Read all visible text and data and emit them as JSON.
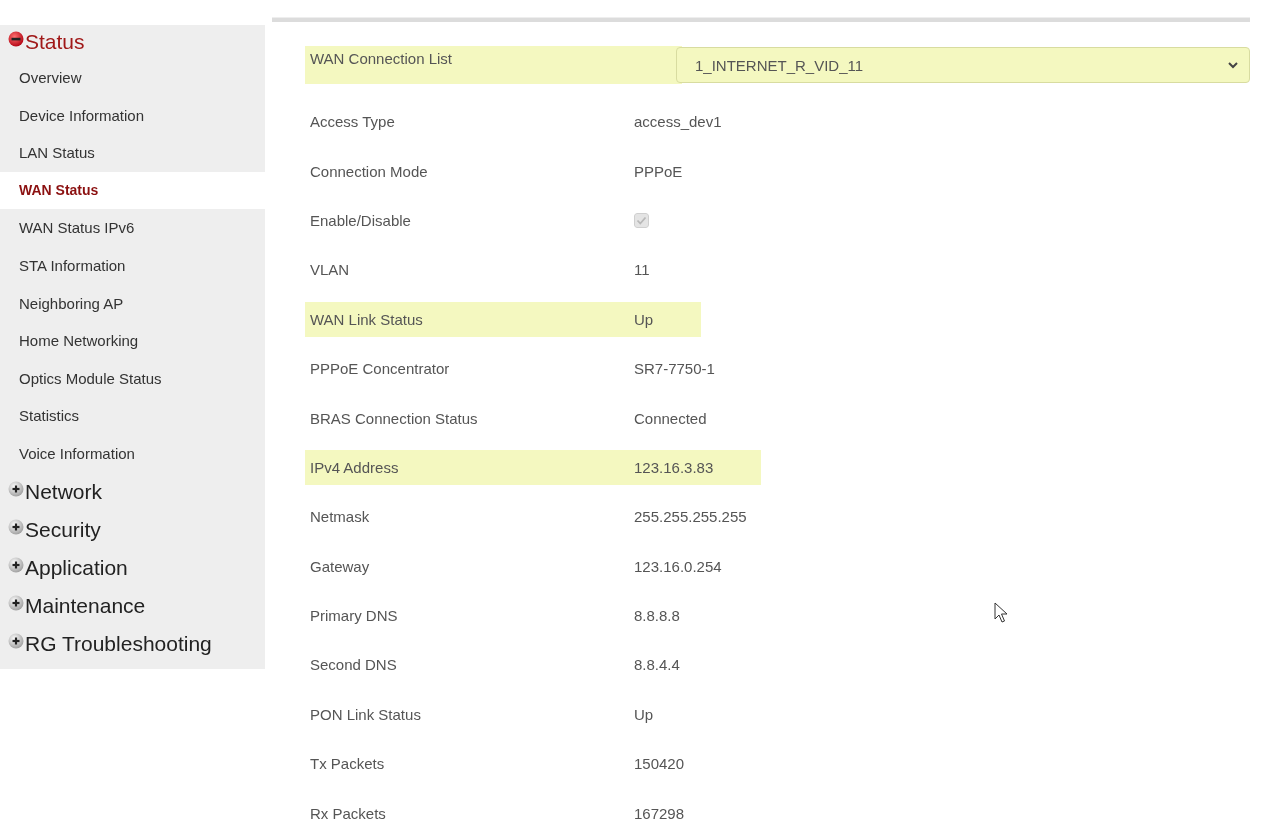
{
  "sidebar": {
    "groups": [
      {
        "label": "Status",
        "expanded": true,
        "items": [
          {
            "label": "Overview",
            "selected": false
          },
          {
            "label": "Device Information",
            "selected": false
          },
          {
            "label": "LAN Status",
            "selected": false
          },
          {
            "label": "WAN Status",
            "selected": true
          },
          {
            "label": "WAN Status IPv6",
            "selected": false
          },
          {
            "label": "STA Information",
            "selected": false
          },
          {
            "label": "Neighboring AP",
            "selected": false
          },
          {
            "label": "Home Networking",
            "selected": false
          },
          {
            "label": "Optics Module Status",
            "selected": false
          },
          {
            "label": "Statistics",
            "selected": false
          },
          {
            "label": "Voice Information",
            "selected": false
          }
        ]
      },
      {
        "label": "Network",
        "expanded": false
      },
      {
        "label": "Security",
        "expanded": false
      },
      {
        "label": "Application",
        "expanded": false
      },
      {
        "label": "Maintenance",
        "expanded": false
      },
      {
        "label": "RG Troubleshooting",
        "expanded": false
      }
    ]
  },
  "details": [
    {
      "kind": "select",
      "label": "WAN Connection List",
      "value": "1_INTERNET_R_VID_11",
      "highlighted": true
    },
    {
      "kind": "text",
      "label": "Access Type",
      "value": "access_dev1",
      "highlighted": false
    },
    {
      "kind": "text",
      "label": "Connection Mode",
      "value": "PPPoE",
      "highlighted": false
    },
    {
      "kind": "checkbox",
      "label": "Enable/Disable",
      "checked": true,
      "disabled": true,
      "highlighted": false
    },
    {
      "kind": "text",
      "label": "VLAN",
      "value": "11",
      "highlighted": false
    },
    {
      "kind": "text",
      "label": "WAN Link Status",
      "value": "Up",
      "highlighted": true
    },
    {
      "kind": "text",
      "label": "PPPoE Concentrator",
      "value": "SR7-7750-1",
      "highlighted": false
    },
    {
      "kind": "text",
      "label": "BRAS Connection Status",
      "value": "Connected",
      "highlighted": false
    },
    {
      "kind": "text",
      "label": "IPv4 Address",
      "value": "123.16.3.83",
      "highlighted": true
    },
    {
      "kind": "text",
      "label": "Netmask",
      "value": "255.255.255.255",
      "highlighted": false
    },
    {
      "kind": "text",
      "label": "Gateway",
      "value": "123.16.0.254",
      "highlighted": false
    },
    {
      "kind": "text",
      "label": "Primary DNS",
      "value": "8.8.8.8",
      "highlighted": false
    },
    {
      "kind": "text",
      "label": "Second DNS",
      "value": "8.8.4.4",
      "highlighted": false
    },
    {
      "kind": "text",
      "label": "PON Link Status",
      "value": "Up",
      "highlighted": false
    },
    {
      "kind": "text",
      "label": "Tx Packets",
      "value": "150420",
      "highlighted": false
    },
    {
      "kind": "text",
      "label": "Rx Packets",
      "value": "167298",
      "highlighted": false
    }
  ]
}
